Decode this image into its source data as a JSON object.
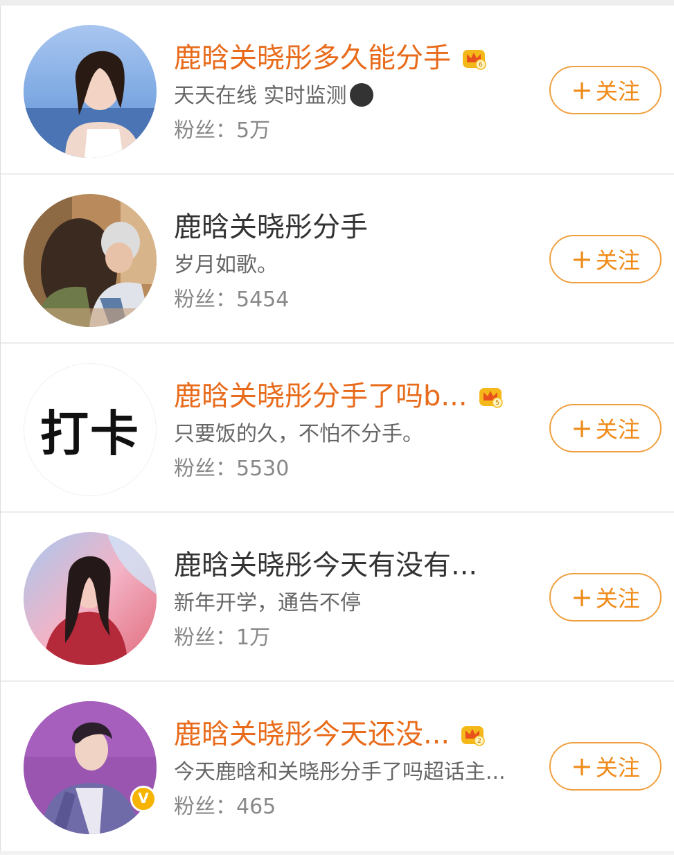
{
  "accent_color": "#e86b1b",
  "button_color": "#f08a18",
  "users": [
    {
      "name": "鹿晗关晓彤多久能分手",
      "vip": true,
      "crown_level": "6",
      "desc": "天天在线 实时监测",
      "desc_icon": "moon-emoji-icon",
      "fans": "粉丝：5万",
      "follow_label": "关注",
      "avatar_kind": "photo-woman-sea"
    },
    {
      "name": "鹿晗关晓彤分手",
      "vip": false,
      "desc": "岁月如歌。",
      "fans": "粉丝：5454",
      "follow_label": "关注",
      "avatar_kind": "photo-couple"
    },
    {
      "name": "鹿晗关晓彤分手了吗b...",
      "vip": true,
      "crown_level": "5",
      "desc": "只要饭的久，不怕不分手。",
      "fans": "粉丝：5530",
      "follow_label": "关注",
      "avatar_text": "打卡"
    },
    {
      "name": "鹿晗关晓彤今天有没有...",
      "vip": false,
      "desc": "新年开学，通告不停",
      "fans": "粉丝：1万",
      "follow_label": "关注",
      "avatar_kind": "photo-woman-pink"
    },
    {
      "name": "鹿晗关晓彤今天还没...",
      "vip": true,
      "crown_level": "2",
      "desc": "今天鹿晗和关晓彤分手了吗超话主...",
      "fans": "粉丝：465",
      "follow_label": "关注",
      "avatar_kind": "photo-man-purple",
      "verified_icon": "verified-badge-icon",
      "verified_glyph": "V"
    }
  ]
}
